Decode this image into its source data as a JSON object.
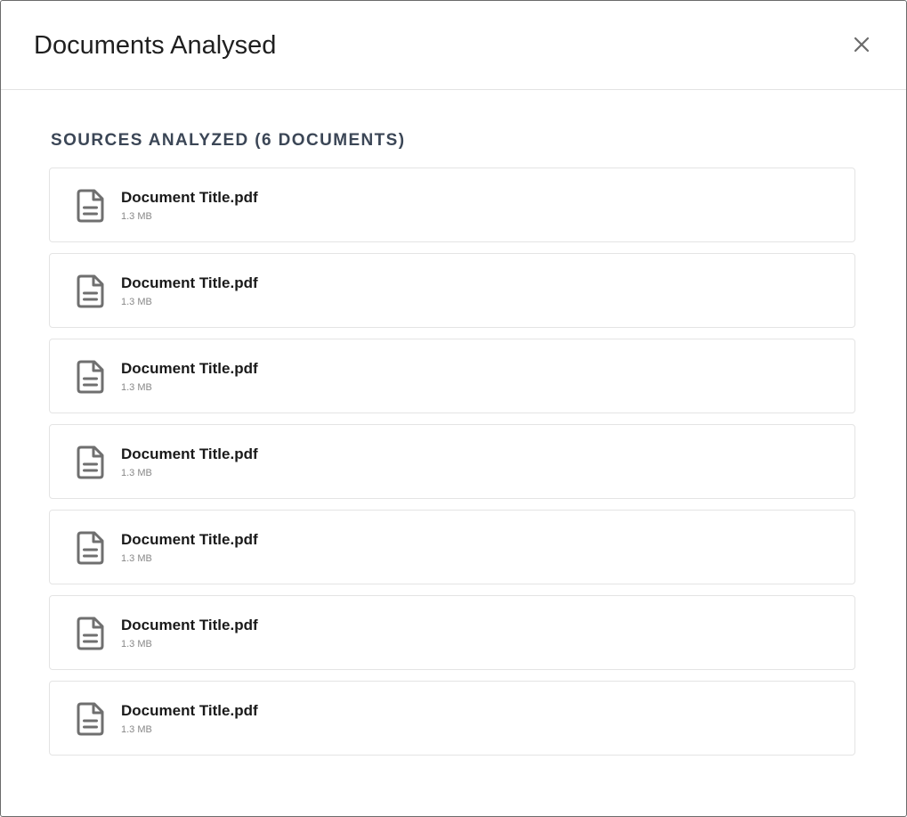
{
  "modal": {
    "title": "Documents Analysed",
    "close_icon": "close-icon"
  },
  "section": {
    "heading": "SOURCES ANALYZED (6 DOCUMENTS)"
  },
  "documents": [
    {
      "name": "Document Title.pdf",
      "size": "1.3 MB",
      "icon": "document-icon"
    },
    {
      "name": "Document Title.pdf",
      "size": "1.3 MB",
      "icon": "document-icon"
    },
    {
      "name": "Document Title.pdf",
      "size": "1.3 MB",
      "icon": "document-icon"
    },
    {
      "name": "Document Title.pdf",
      "size": "1.3 MB",
      "icon": "document-icon"
    },
    {
      "name": "Document Title.pdf",
      "size": "1.3 MB",
      "icon": "document-icon"
    },
    {
      "name": "Document Title.pdf",
      "size": "1.3 MB",
      "icon": "document-icon"
    },
    {
      "name": "Document Title.pdf",
      "size": "1.3 MB",
      "icon": "document-icon"
    }
  ],
  "colors": {
    "icon": "#6f6f6f",
    "heading": "#3b4656",
    "border": "#e4e4e4"
  }
}
